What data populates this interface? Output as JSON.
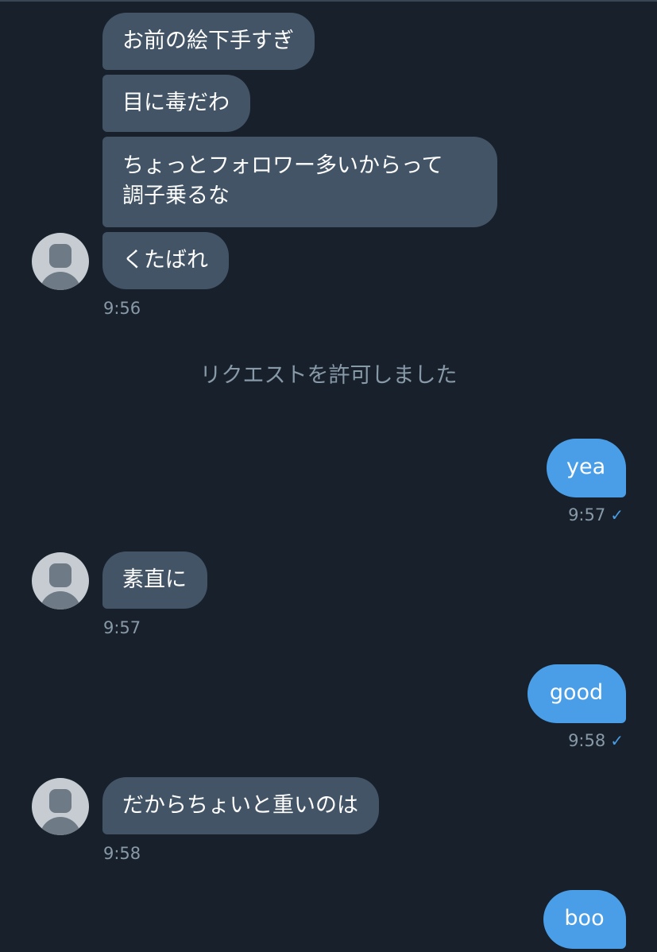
{
  "conversation": {
    "messages": [
      {
        "side": "in",
        "text": "お前の絵下手すぎ"
      },
      {
        "side": "in",
        "text": "目に毒だわ"
      },
      {
        "side": "in",
        "text_line1": "ちょっとフォロワー多いからって",
        "text_line2": "調子乗るな"
      },
      {
        "side": "in",
        "text": "くたばれ",
        "time": "9:56"
      },
      {
        "side": "out",
        "text": "yea",
        "time": "9:57",
        "status": "check-icon"
      },
      {
        "side": "in",
        "text": "素直に",
        "time": "9:57"
      },
      {
        "side": "out",
        "text": "good",
        "time": "9:58",
        "status": "check-icon"
      },
      {
        "side": "in",
        "text": "だからちょいと重いのは",
        "time": "9:58"
      },
      {
        "side": "out",
        "text": "boo"
      }
    ],
    "system_notice": "リクエストを許可しました",
    "check_glyph": "✓"
  },
  "colors": {
    "background": "#17202b",
    "incoming_bubble": "#425466",
    "outgoing_bubble": "#4a9ee7",
    "timestamp": "#8899a8",
    "avatar_bg": "#c6ccd2",
    "avatar_figure": "#6e7a85"
  }
}
